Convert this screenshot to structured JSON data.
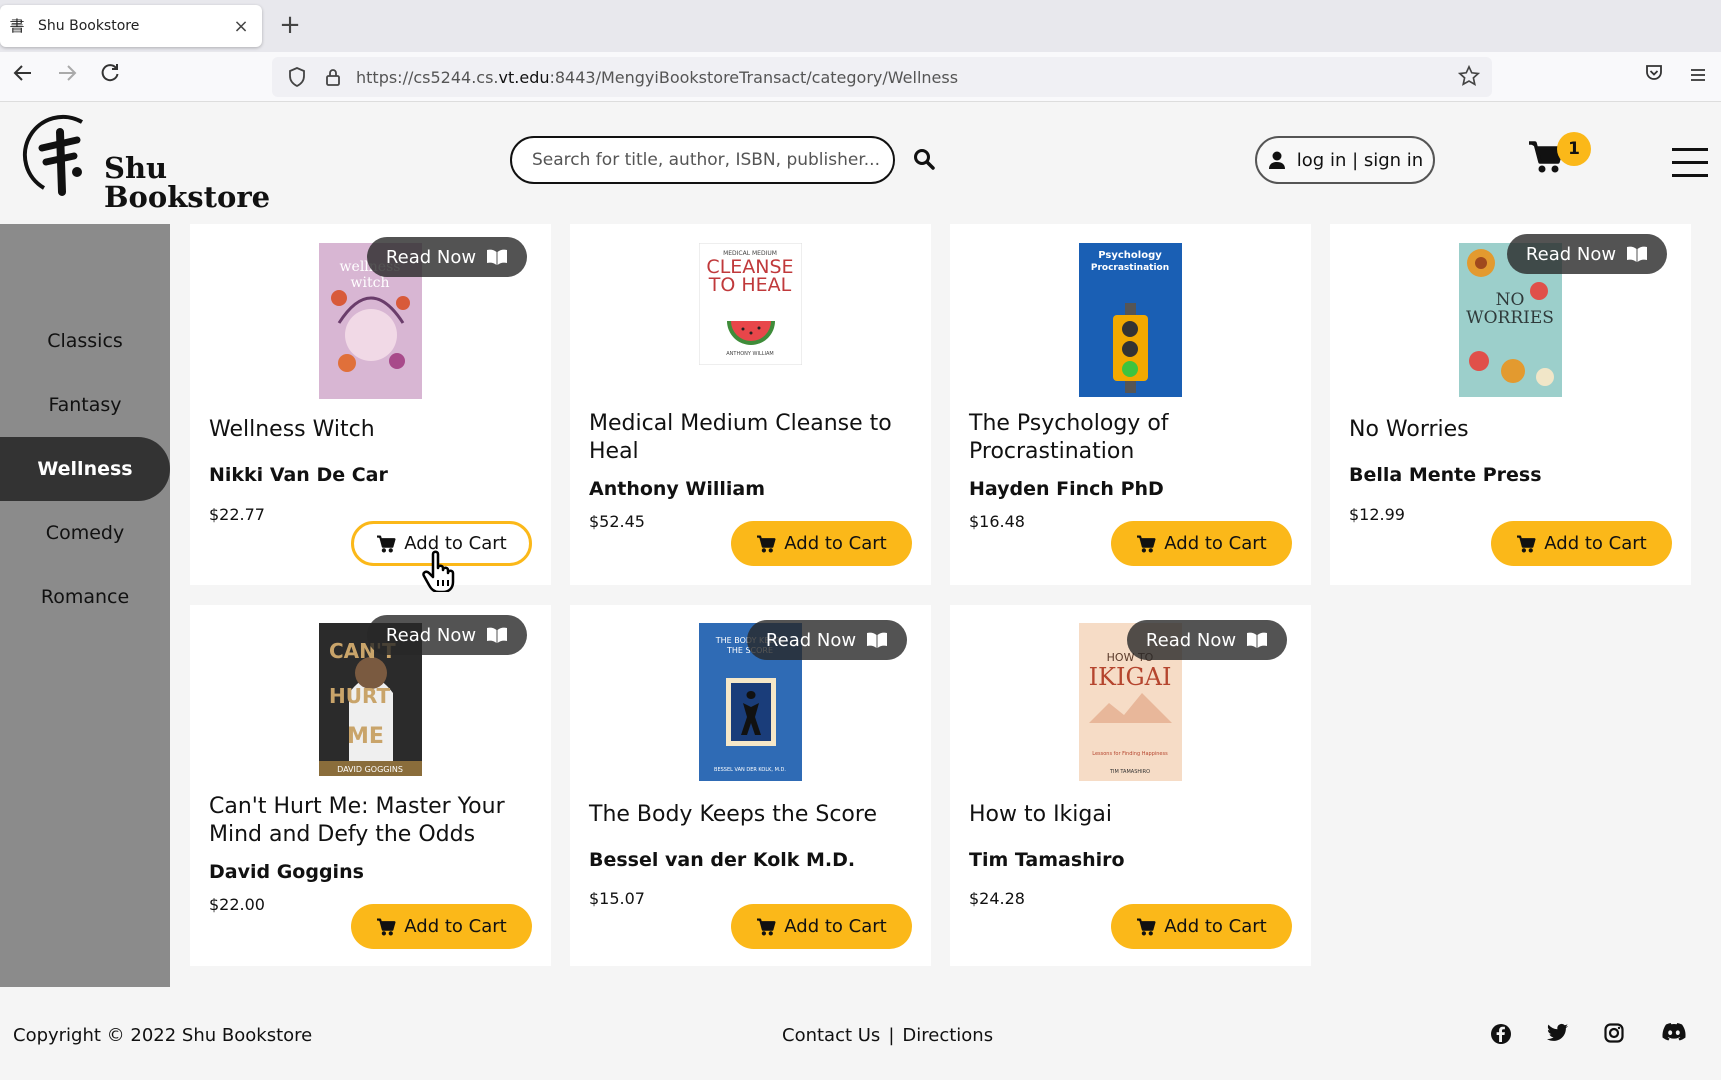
{
  "browser": {
    "tab_title": "Shu Bookstore",
    "url_prefix": "https://cs5244.cs.",
    "url_domain": "vt.edu",
    "url_suffix": ":8443/MengyiBookstoreTransact/category/Wellness"
  },
  "header": {
    "logo_line1": "Shu",
    "logo_line2": "Bookstore",
    "search_placeholder": "Search for title, author, ISBN, publisher...",
    "login_label": "log in | sign in",
    "cart_count": "1"
  },
  "sidebar": {
    "items": [
      {
        "label": "Classics"
      },
      {
        "label": "Fantasy"
      },
      {
        "label": "Wellness"
      },
      {
        "label": "Comedy"
      },
      {
        "label": "Romance"
      }
    ],
    "active": "Wellness"
  },
  "labels": {
    "read_now": "Read Now",
    "add_to_cart": "Add to Cart"
  },
  "books": [
    {
      "title": "Wellness Witch",
      "author": "Nikki Van De Car",
      "price": "$22.77",
      "read_now": true,
      "cover_color": "#c9a8c6"
    },
    {
      "title": "Medical Medium Cleanse to Heal",
      "author": "Anthony William",
      "price": "$52.45",
      "read_now": false,
      "cover_color": "#ffffff"
    },
    {
      "title": "The Psychology of Procrastination",
      "author": "Hayden Finch PhD",
      "price": "$16.48",
      "read_now": false,
      "cover_color": "#1a5fb4"
    },
    {
      "title": "No Worries",
      "author": "Bella Mente Press",
      "price": "$12.99",
      "read_now": true,
      "cover_color": "#9ccfcb"
    },
    {
      "title": "Can't Hurt Me: Master Your Mind and Defy the Odds",
      "author": "David Goggins",
      "price": "$22.00",
      "read_now": true,
      "cover_color": "#2b2b2b"
    },
    {
      "title": "The Body Keeps the Score",
      "author": "Bessel van der Kolk M.D.",
      "price": "$15.07",
      "read_now": true,
      "cover_color": "#2f6bb5"
    },
    {
      "title": "How to Ikigai",
      "author": "Tim Tamashiro",
      "price": "$24.28",
      "read_now": true,
      "cover_color": "#f6dcc6"
    }
  ],
  "footer": {
    "copyright": "Copyright © 2022 Shu Bookstore",
    "contact": "Contact Us",
    "separator": "|",
    "directions": "Directions"
  },
  "colors": {
    "accent": "#fbb819",
    "sidebar": "#8b8b8b",
    "active": "#333333"
  }
}
